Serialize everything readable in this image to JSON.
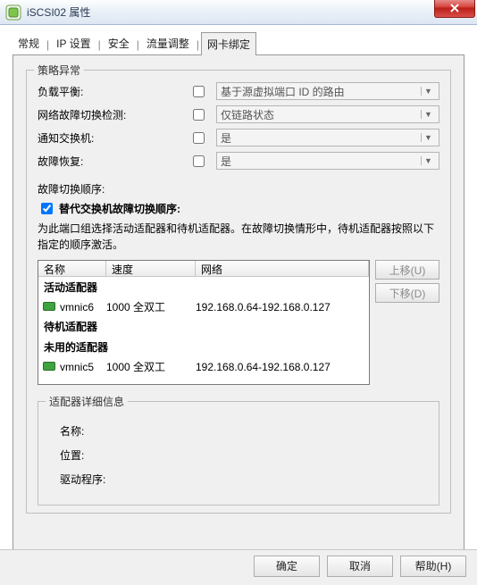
{
  "window": {
    "title": "iSCSI02 属性"
  },
  "tabs": {
    "general": "常规",
    "ip": "IP 设置",
    "security": "安全",
    "traffic": "流量调整",
    "nic": "网卡绑定"
  },
  "policy": {
    "legend": "策略异常",
    "loadBalance": {
      "label": "负载平衡:",
      "value": "基于源虚拟端口 ID 的路由"
    },
    "failDetect": {
      "label": "网络故障切换检测:",
      "value": "仅链路状态"
    },
    "notifySwitches": {
      "label": "通知交换机:",
      "value": "是"
    },
    "failback": {
      "label": "故障恢复:",
      "value": "是"
    }
  },
  "failover": {
    "orderLabel": "故障切换顺序:",
    "overrideLabel": "替代交换机故障切换顺序:",
    "desc": "为此端口组选择活动适配器和待机适配器。在故障切换情形中，待机适配器按照以下指定的顺序激活。"
  },
  "list": {
    "headers": {
      "name": "名称",
      "speed": "速度",
      "network": "网络"
    },
    "groups": {
      "active": "活动适配器",
      "standby": "待机适配器",
      "unused": "未用的适配器"
    },
    "items": [
      {
        "group": "active",
        "name": "vmnic6",
        "speed": "1000 全双工",
        "network": "192.168.0.64-192.168.0.127"
      },
      {
        "group": "unused",
        "name": "vmnic5",
        "speed": "1000 全双工",
        "network": "192.168.0.64-192.168.0.127"
      }
    ]
  },
  "sideButtons": {
    "moveUp": "上移(U)",
    "moveDown": "下移(D)"
  },
  "details": {
    "legend": "适配器详细信息",
    "name": "名称:",
    "location": "位置:",
    "driver": "驱动程序:"
  },
  "footer": {
    "ok": "确定",
    "cancel": "取消",
    "help": "帮助(H)"
  }
}
